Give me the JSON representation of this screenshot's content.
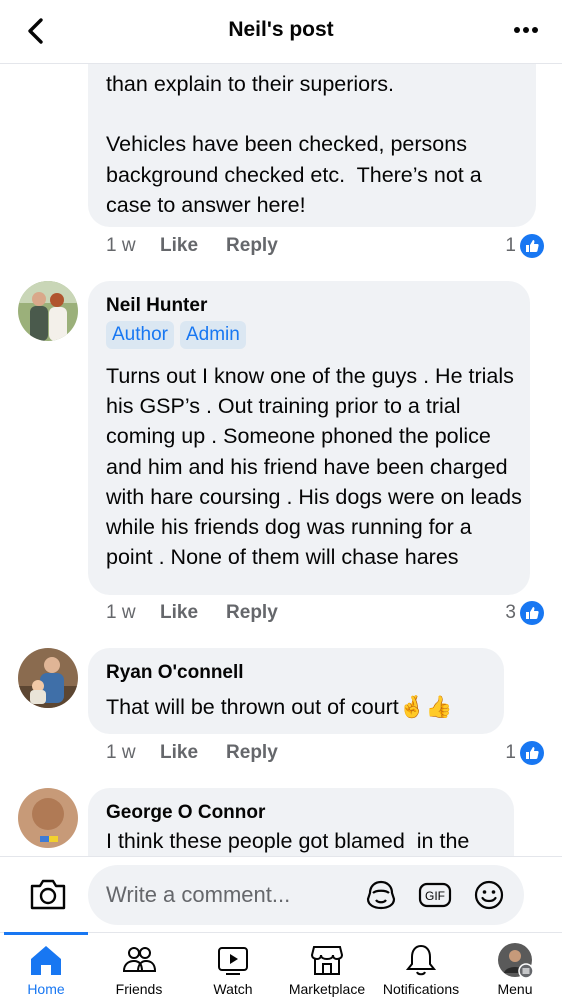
{
  "header": {
    "title": "Neil's post"
  },
  "comments": [
    {
      "author": "",
      "text": "than explain to their superiors.\n\nVehicles have been checked, persons background checked etc.  There’s not a case to answer here!",
      "time": "1 w",
      "like_label": "Like",
      "reply_label": "Reply",
      "reactions": "1"
    },
    {
      "author": "Neil Hunter",
      "badges": [
        "Author",
        "Admin"
      ],
      "text": "Turns out I know one of the guys . He trials his GSP’s . Out training prior to a trial coming up . Someone phoned the police and him and his friend have been charged with hare coursing . His dogs were on leads while his friends dog was running for a point . None of them will chase hares",
      "time": "1 w",
      "like_label": "Like",
      "reply_label": "Reply",
      "reactions": "3"
    },
    {
      "author": "Ryan O'connell",
      "text": "That will be thrown out of court",
      "emojis": "🤞👍",
      "time": "1 w",
      "like_label": "Like",
      "reply_label": "Reply",
      "reactions": "1"
    },
    {
      "author": "George O Connor",
      "text": "I think these people got blamed  in the"
    }
  ],
  "composer": {
    "placeholder": "Write a comment..."
  },
  "tabs": [
    {
      "label": "Home",
      "icon": "home-icon",
      "active": true
    },
    {
      "label": "Friends",
      "icon": "friends-icon"
    },
    {
      "label": "Watch",
      "icon": "watch-icon"
    },
    {
      "label": "Marketplace",
      "icon": "marketplace-icon"
    },
    {
      "label": "Notifications",
      "icon": "bell-icon"
    },
    {
      "label": "Menu",
      "icon": "menu-avatar"
    }
  ],
  "colors": {
    "accent": "#1877f2",
    "bubble": "#f0f2f5",
    "meta": "#65676b"
  }
}
